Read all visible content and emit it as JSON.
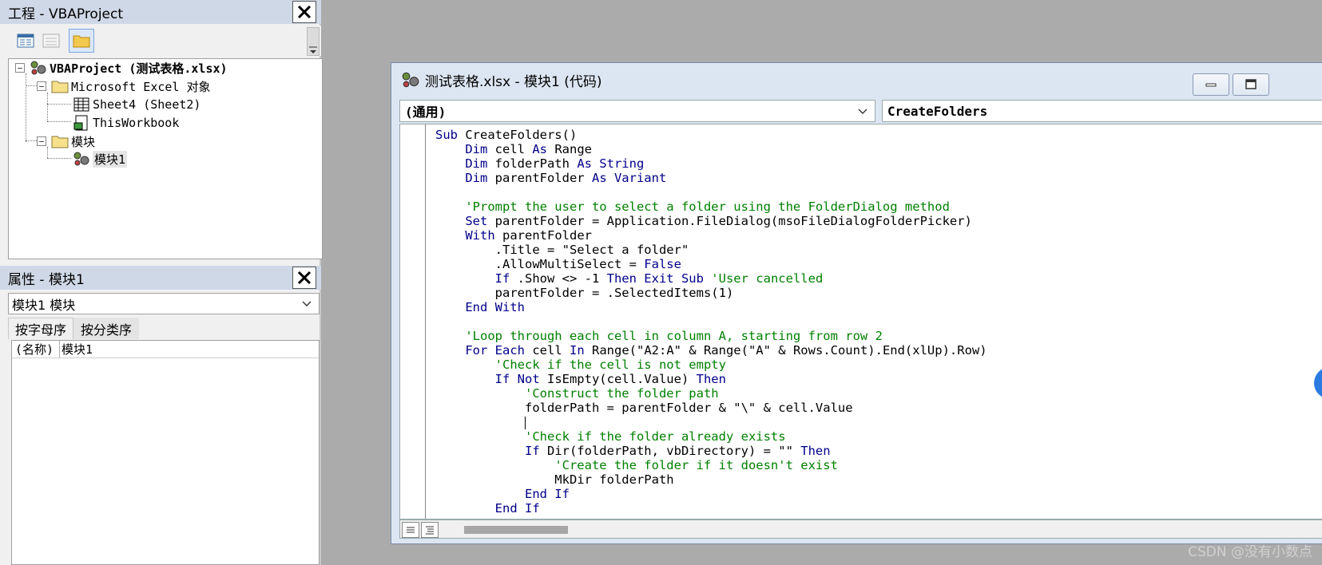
{
  "project_pane": {
    "title": "工程 - VBAProject",
    "tree": {
      "root": "VBAProject (测试表格.xlsx)",
      "excel_objects_folder": "Microsoft Excel 对象",
      "sheet_item": "Sheet4 (Sheet2)",
      "workbook_item": "ThisWorkbook",
      "modules_folder": "模块",
      "module_item": "模块1"
    }
  },
  "properties_pane": {
    "title": "属性 - 模块1",
    "object_select": "模块1 模块",
    "tabs": [
      "按字母序",
      "按分类序"
    ],
    "rows": [
      {
        "name": "(名称)",
        "value": "模块1"
      }
    ]
  },
  "code_window": {
    "title": "测试表格.xlsx - 模块1 (代码)",
    "object_combo": "(通用)",
    "procedure_combo": "CreateFolders"
  },
  "code_lines": [
    [
      [
        "kw",
        "Sub "
      ],
      [
        "tx",
        "CreateFolders()"
      ]
    ],
    [
      [
        "tx",
        "    "
      ],
      [
        "kw",
        "Dim "
      ],
      [
        "tx",
        "cell "
      ],
      [
        "kw",
        "As "
      ],
      [
        "tx",
        "Range"
      ]
    ],
    [
      [
        "tx",
        "    "
      ],
      [
        "kw",
        "Dim "
      ],
      [
        "tx",
        "folderPath "
      ],
      [
        "kw",
        "As String"
      ]
    ],
    [
      [
        "tx",
        "    "
      ],
      [
        "kw",
        "Dim "
      ],
      [
        "tx",
        "parentFolder "
      ],
      [
        "kw",
        "As Variant"
      ]
    ],
    [
      [
        "tx",
        ""
      ]
    ],
    [
      [
        "tx",
        "    "
      ],
      [
        "cm",
        "'Prompt the user to select a folder using the FolderDialog method"
      ]
    ],
    [
      [
        "tx",
        "    "
      ],
      [
        "kw",
        "Set "
      ],
      [
        "tx",
        "parentFolder = Application.FileDialog(msoFileDialogFolderPicker)"
      ]
    ],
    [
      [
        "tx",
        "    "
      ],
      [
        "kw",
        "With "
      ],
      [
        "tx",
        "parentFolder"
      ]
    ],
    [
      [
        "tx",
        "        .Title = \"Select a folder\""
      ]
    ],
    [
      [
        "tx",
        "        .AllowMultiSelect = "
      ],
      [
        "kw",
        "False"
      ]
    ],
    [
      [
        "tx",
        "        "
      ],
      [
        "kw",
        "If "
      ],
      [
        "tx",
        ".Show <> -1 "
      ],
      [
        "kw",
        "Then Exit Sub "
      ],
      [
        "cm",
        "'User cancelled"
      ]
    ],
    [
      [
        "tx",
        "        parentFolder = .SelectedItems(1)"
      ]
    ],
    [
      [
        "tx",
        "    "
      ],
      [
        "kw",
        "End With"
      ]
    ],
    [
      [
        "tx",
        ""
      ]
    ],
    [
      [
        "tx",
        "    "
      ],
      [
        "cm",
        "'Loop through each cell in column A, starting from row 2"
      ]
    ],
    [
      [
        "tx",
        "    "
      ],
      [
        "kw",
        "For Each "
      ],
      [
        "tx",
        "cell "
      ],
      [
        "kw",
        "In "
      ],
      [
        "tx",
        "Range(\"A2:A\" & Range(\"A\" & Rows.Count).End(xlUp).Row)"
      ]
    ],
    [
      [
        "tx",
        "        "
      ],
      [
        "cm",
        "'Check if the cell is not empty"
      ]
    ],
    [
      [
        "tx",
        "        "
      ],
      [
        "kw",
        "If Not "
      ],
      [
        "tx",
        "IsEmpty(cell.Value) "
      ],
      [
        "kw",
        "Then"
      ]
    ],
    [
      [
        "tx",
        "            "
      ],
      [
        "cm",
        "'Construct the folder path"
      ]
    ],
    [
      [
        "tx",
        "            folderPath = parentFolder & \"\\\" & cell.Value"
      ]
    ],
    [
      [
        "tx",
        "            "
      ],
      [
        "caret",
        ""
      ]
    ],
    [
      [
        "tx",
        "            "
      ],
      [
        "cm",
        "'Check if the folder already exists"
      ]
    ],
    [
      [
        "tx",
        "            "
      ],
      [
        "kw",
        "If "
      ],
      [
        "tx",
        "Dir(folderPath, vbDirectory) = \"\" "
      ],
      [
        "kw",
        "Then"
      ]
    ],
    [
      [
        "tx",
        "                "
      ],
      [
        "cm",
        "'Create the folder if it doesn't exist"
      ]
    ],
    [
      [
        "tx",
        "                MkDir folderPath"
      ]
    ],
    [
      [
        "tx",
        "            "
      ],
      [
        "kw",
        "End If"
      ]
    ],
    [
      [
        "tx",
        "        "
      ],
      [
        "kw",
        "End If"
      ]
    ]
  ],
  "colors": {
    "keyword": "#00008b",
    "comment": "#008000",
    "title_bar": "#cfd8e6",
    "code_window_frame": "#dce6f2"
  },
  "watermark": "CSDN @没有小数点"
}
